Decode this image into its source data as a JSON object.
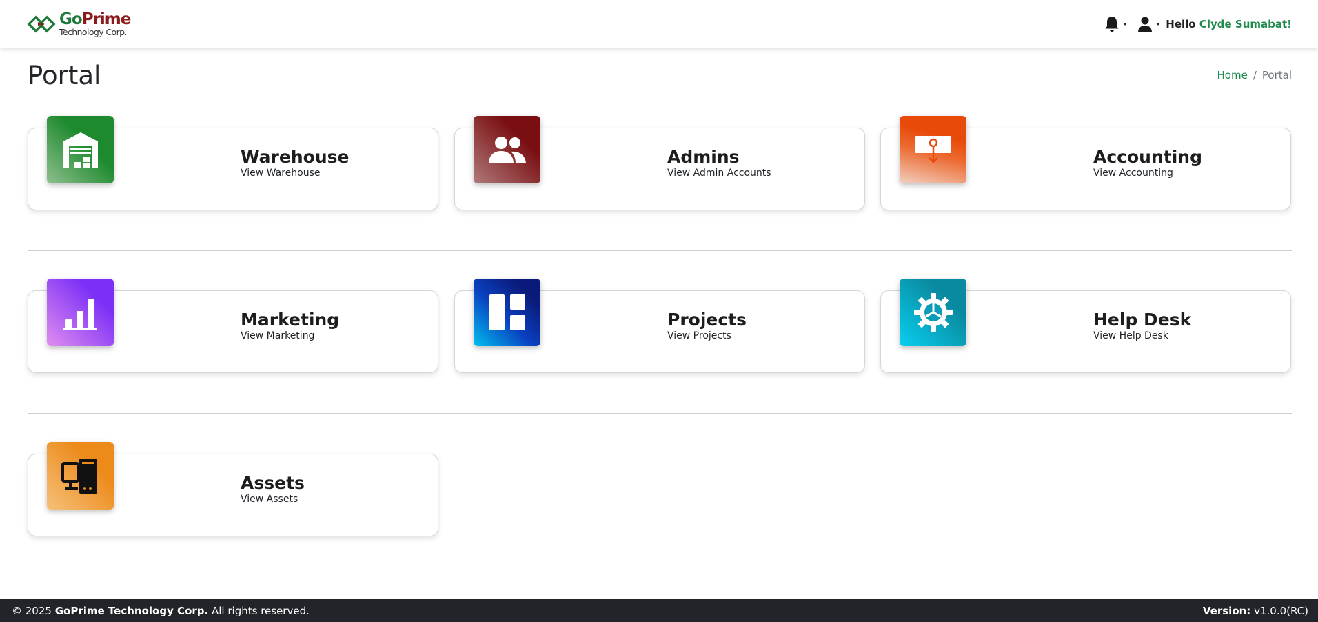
{
  "brand": {
    "logo_go": "Go",
    "logo_prime": "Prime",
    "logo_sub": "Technology Corp."
  },
  "navbar": {
    "notifications_icon": "bell-icon",
    "user_icon": "user-icon",
    "greeting": "Hello",
    "username": "Clyde Sumabat!"
  },
  "page": {
    "title": "Portal"
  },
  "breadcrumb": {
    "home": "Home",
    "separator": "/",
    "current": "Portal"
  },
  "cards": [
    {
      "title": "Warehouse",
      "subtitle": "View Warehouse",
      "icon": "warehouse-icon",
      "colors": [
        "#1e8a2e",
        "#8fbf8f"
      ]
    },
    {
      "title": "Admins",
      "subtitle": "View Admin Accounts",
      "icon": "users-icon",
      "colors": [
        "#7a0f12",
        "#b07a7a"
      ]
    },
    {
      "title": "Accounting",
      "subtitle": "View Accounting",
      "icon": "accounting-icon",
      "colors": [
        "#e84a0a",
        "#f2cfc0"
      ]
    },
    {
      "title": "Marketing",
      "subtitle": "View Marketing",
      "icon": "bar-chart-icon",
      "colors": [
        "#7b2ff7",
        "#e08ef0"
      ]
    },
    {
      "title": "Projects",
      "subtitle": "View Projects",
      "icon": "dashboard-icon",
      "colors": [
        "#0a1a7a",
        "#00c0f0"
      ]
    },
    {
      "title": "Help Desk",
      "subtitle": "View Help Desk",
      "icon": "gear-icon",
      "colors": [
        "#0a8aa0",
        "#08d0f0"
      ]
    },
    {
      "title": "Assets",
      "subtitle": "View Assets",
      "icon": "computer-icon",
      "colors": [
        "#ec8a1a",
        "#f6c07a"
      ]
    }
  ],
  "footer": {
    "copyright_prefix": "© 2025",
    "company": "GoPrime Technology Corp.",
    "rights": "All rights reserved.",
    "version_label": "Version:",
    "version_value": "v1.0.0(RC)"
  }
}
